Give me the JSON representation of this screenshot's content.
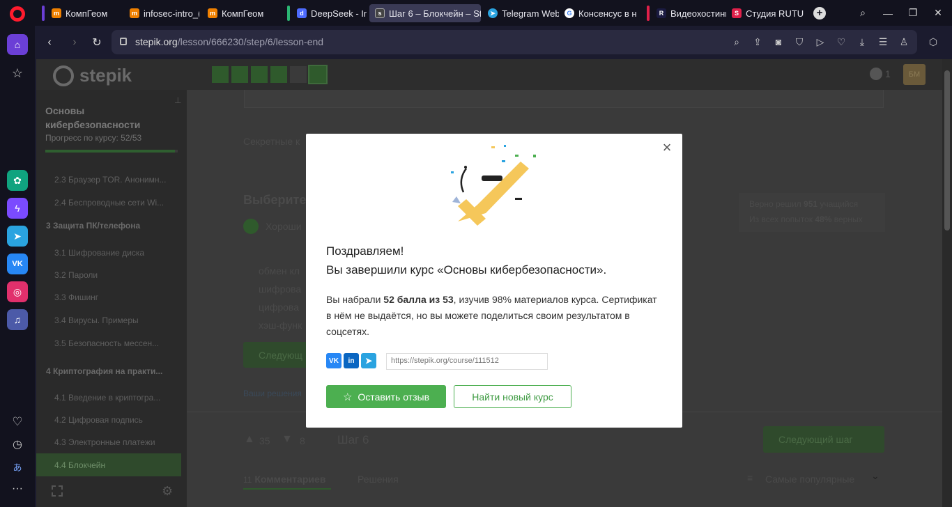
{
  "browser": {
    "tabs": [
      {
        "label": "КомпГеом",
        "fav": "m",
        "favColor": "#f08000"
      },
      {
        "label": "infosec-intro_(",
        "fav": "m",
        "favColor": "#f08000"
      },
      {
        "label": "КомпГеом",
        "fav": "m",
        "favColor": "#f08000"
      },
      {
        "label": "DeepSeek - Inte",
        "fav": "d",
        "favColor": "#4d6bfe"
      },
      {
        "label": "Шаг 6 – Блокчейн – Step",
        "fav": "s",
        "favColor": "#555"
      },
      {
        "label": "Telegram Web",
        "fav": "t",
        "favColor": "#2aa3e0"
      },
      {
        "label": "Консенсус в не",
        "fav": "G",
        "favColor": "#ffffff"
      },
      {
        "label": "Видеохостинг I",
        "fav": "R",
        "favColor": "#1a1a40"
      },
      {
        "label": "Студия RUTUBE",
        "fav": "S",
        "favColor": "#e0204a"
      }
    ],
    "url_host": "stepik.org",
    "url_path": "/lesson/666230/step/6/lesson-end",
    "sidebar_icons": [
      "home-icon",
      "star-icon",
      "chatgpt-icon",
      "messenger-icon",
      "telegram-icon",
      "vk-icon",
      "instagram-icon",
      "music-icon",
      "heart-icon",
      "history-icon",
      "translate-icon",
      "more-icon"
    ]
  },
  "stepik": {
    "logo": "stepik",
    "course_title": "Основы кибербезопасности",
    "progress_label": "Прогресс по курсу:",
    "progress_value": "52/53",
    "nav": [
      {
        "label": "2.3  Браузер TOR. Анонимн...",
        "type": "item"
      },
      {
        "label": "2.4  Беспроводные сети Wi...",
        "type": "item"
      },
      {
        "label": "3  Защита ПК/телефона",
        "type": "sec"
      },
      {
        "label": "3.1  Шифрование диска",
        "type": "item"
      },
      {
        "label": "3.2  Пароли",
        "type": "item"
      },
      {
        "label": "3.3  Фишинг",
        "type": "item"
      },
      {
        "label": "3.4  Вирусы. Примеры",
        "type": "item"
      },
      {
        "label": "3.5  Безопасность мессен...",
        "type": "item"
      },
      {
        "label": "4  Криптография на практи...",
        "type": "sec"
      },
      {
        "label": "4.1  Введение в криптогра...",
        "type": "item"
      },
      {
        "label": "4.2  Цифровая подпись",
        "type": "item"
      },
      {
        "label": "4.3  Электронные платежи",
        "type": "item"
      },
      {
        "label": "4.4  Блокчейн",
        "type": "active"
      }
    ],
    "bg": {
      "secret": "Секретные к",
      "choose": "Выберите",
      "good": "Хороши",
      "opt1": "обмен кл",
      "opt2": "шифрова",
      "opt3": "цифрова",
      "opt4": "хэш-функ",
      "next_btn": "Следующ",
      "your_solutions": "Ваши решения",
      "solved_1": "Верно решил",
      "solved_n": "951",
      "solved_2": "учащийся",
      "attempts_1": "Из всех попыток",
      "attempts_n": "48%",
      "attempts_2": "верных",
      "likes": "35",
      "dislikes": "8",
      "step": "Шаг 6",
      "next_step": "Следующий шаг",
      "comments_n": "11",
      "comments": "Комментариев",
      "solutions": "Решения",
      "sort": "Самые популярные",
      "notif_count": "1",
      "avatar": "БМ"
    }
  },
  "modal": {
    "title1": "Поздравляем!",
    "title2": "Вы завершили курс «Основы кибербезопасности».",
    "text_a": "Вы набрали ",
    "text_b": "52 балла из 53",
    "text_c": ", изучив 98% материалов курса. Сертификат в нём не выдаётся, но вы можете поделиться своим результатом в соцсетях.",
    "share_url": "https://stepik.org/course/111512",
    "review_btn": "Оставить отзыв",
    "find_btn": "Найти новый курс",
    "social": [
      "VK",
      "in",
      "tg"
    ]
  }
}
